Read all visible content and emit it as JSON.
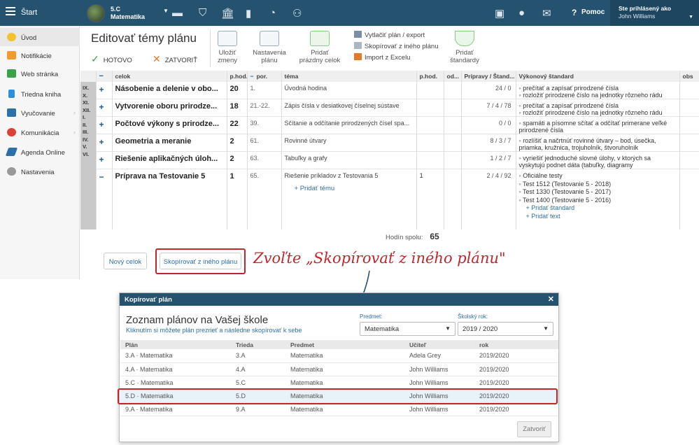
{
  "topbar": {
    "start": "Štart",
    "class_code": "5.C",
    "subject": "Matematika",
    "help": "Pomoc",
    "user_label": "Ste prihlásený ako",
    "user_name": "John Williams",
    "icons": [
      "classbook-icon",
      "shield-icon",
      "school-icon",
      "chart-icon",
      "clock-icon",
      "students-icon",
      "export-icon",
      "chat-icon",
      "mail-icon",
      "help-icon"
    ]
  },
  "sidebar": {
    "items": [
      {
        "label": "Úvod",
        "icon": "star-icon",
        "color": "#f2c230"
      },
      {
        "label": "Notifikácie",
        "icon": "mail-icon",
        "color": "#f29a30"
      },
      {
        "label": "Web stránka",
        "icon": "home-icon",
        "color": "#3aa34a"
      },
      {
        "label": "Triedna kniha",
        "icon": "book-icon",
        "color": "#2f8fd8"
      },
      {
        "label": "Vyučovanie",
        "icon": "open-book-icon",
        "color": "#2f6fa8"
      },
      {
        "label": "Komunikácia",
        "icon": "chat-icon",
        "color": "#d9413a"
      },
      {
        "label": "Agenda Online",
        "icon": "pen-icon",
        "color": "#2f6fa8"
      },
      {
        "label": "Nastavenia",
        "icon": "gear-icon",
        "color": "#999999"
      }
    ]
  },
  "toolbar": {
    "title": "Editovať témy plánu",
    "ok": "HOTOVO",
    "close": "ZATVORIŤ",
    "save_l1": "Uložiť",
    "save_l2": "zmeny",
    "settings_l1": "Nastavenia",
    "settings_l2": "plánu",
    "add_l1": "Pridať",
    "add_l2": "prázdny celok",
    "print": "Vytlačiť plán / export",
    "copy": "Skopírovať z iného plánu",
    "import": "Import z Excelu",
    "standards_l1": "Pridať",
    "standards_l2": "štandardy"
  },
  "table": {
    "headers": {
      "celok": "celok",
      "phod": "p.hod.",
      "por": "por.",
      "tema": "téma",
      "phod2": "p.hod.",
      "od": "od...",
      "pripravy": "Prípravy / Štand...",
      "standard": "Výkonový štandard",
      "obs": "obs"
    },
    "months": [
      "IX.",
      "X.",
      "XI.",
      "XII.",
      "I.",
      "II.",
      "III.",
      "IV.",
      "V.",
      "VI."
    ],
    "rows": [
      {
        "celok": "Násobenie a delenie v obo...",
        "phod": "20",
        "por": "1.",
        "tema": "Úvodná hodina",
        "phod2": "",
        "prip": "24 / 0",
        "std": [
          "prečítať a zapísať prirodzené čísla",
          "rozložiť prirodzené číslo na jednotky rôzneho rádu"
        ]
      },
      {
        "celok": "Vytvorenie oboru prirodze...",
        "phod": "18",
        "por": "21.-22.",
        "tema": "Zápis čísla v desiatkovej číselnej sústave",
        "phod2": "",
        "prip": "7 / 4 / 78",
        "std": [
          "prečítať a zapísať prirodzené čísla",
          "rozložiť prirodzené číslo na jednotky rôzneho rádu"
        ]
      },
      {
        "celok": "Počtové výkony s prirodze...",
        "phod": "22",
        "por": "39.",
        "tema": "Sčítanie a odčítanie prirodzených čísel spa...",
        "phod2": "",
        "prip": "0 / 0",
        "std": [
          "spamäti a písomne sčítať a odčítať primerane veľké prirodzené čísla"
        ]
      },
      {
        "celok": "Geometria a meranie",
        "phod": "2",
        "por": "61.",
        "tema": "Rovinné útvary",
        "phod2": "",
        "prip": "8 / 3 / 7",
        "std": [
          "rozlíšiť a načrtnúť rovinné útvary – bod, úsečka, priamka, kružnica, trojuholník, štvoruholník"
        ]
      },
      {
        "celok": "Riešenie aplikačných úloh...",
        "phod": "2",
        "por": "63.",
        "tema": "Tabuľky a grafy",
        "phod2": "",
        "prip": "1 / 2 / 7",
        "std": [
          "vyriešiť jednoduché slovné úlohy, v ktorých sa vyskytujú podnet dáta (tabuľky, diagramy"
        ]
      },
      {
        "celok": "Príprava na Testovanie 5",
        "phod": "1",
        "por": "65.",
        "tema": "Riešenie príkladov z Testovania 5",
        "phod2": "1",
        "prip": "2 / 4 / 92",
        "std": [
          "Oficiálne testy",
          "Test 1512 (Testovanie 5 - 2018)",
          "Test 1330 (Testovanie 5 - 2017)",
          "Test 1400 (Testovanie 5 - 2016)"
        ]
      }
    ],
    "add_topic": "Pridať tému",
    "add_standard": "Pridať štandard",
    "add_text": "Pridať text",
    "total_label": "Hodín spolu:",
    "total_value": "65"
  },
  "buttons": {
    "new_unit": "Nový celok",
    "copy_plan": "Skopírovať z iného plánu"
  },
  "annotation": "Zvoľte „Skopírovať z iného plánu\"",
  "modal": {
    "header": "Kopírovať plán",
    "title": "Zoznam plánov na Vašej škole",
    "subtitle": "Kliknutím si môžete plán prezrieť a následne skopírovať k sebe",
    "subject_label": "Predmet:",
    "subject_value": "Matematika",
    "year_label": "Školský rok:",
    "year_value": "2019 / 2020",
    "columns": [
      "Plán",
      "Trieda",
      "Predmet",
      "Učiteľ",
      "rok"
    ],
    "rows": [
      [
        "3.A · Matematika",
        "3.A",
        "Matematika",
        "Adela Grey",
        "2019/2020"
      ],
      [
        "4.A · Matematika",
        "4.A",
        "Matematika",
        "John Williams",
        "2019/2020"
      ],
      [
        "5.C · Matematika",
        "5.C",
        "Matematika",
        "John Williams",
        "2019/2020"
      ],
      [
        "5.D · Matematika",
        "5.D",
        "Matematika",
        "John Williams",
        "2019/2020"
      ],
      [
        "9.A · Matematika",
        "9.A",
        "Matematika",
        "John Williams",
        "2019/2020"
      ]
    ],
    "selected_row": 3,
    "close": "Zatvoriť"
  },
  "colors": {
    "topbar": "#24526f",
    "highlight": "#c0272d",
    "link": "#2f6fa8"
  }
}
